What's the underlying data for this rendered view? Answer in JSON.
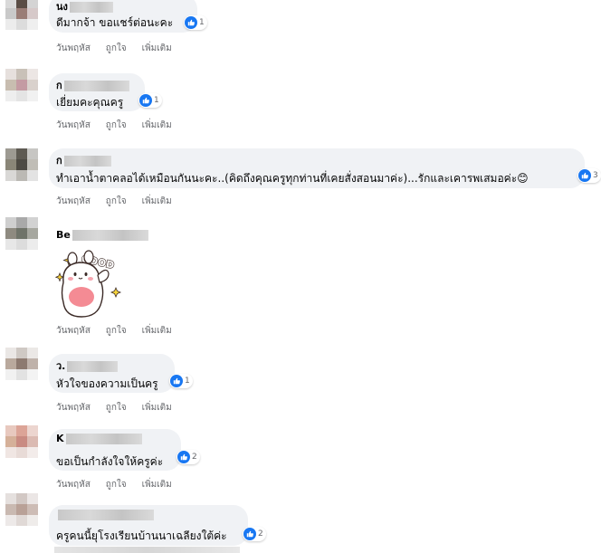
{
  "colors": {
    "bubble": "#f0f2f5",
    "like_blue": "#1877f2",
    "meta_gray": "#65676b"
  },
  "actions": {
    "translate": "วันพฤหัส",
    "like": "ถูกใจ",
    "more": "เพิ่มเติม"
  },
  "comments": [
    {
      "name": "นง",
      "text": "ดีมากจ้า ขอแชร์ต่อนะคะ",
      "reactions": "1",
      "reaction_icon": "like-icon"
    },
    {
      "name": "ก",
      "text": "เยี่ยมคะคุณครู",
      "reactions": "1",
      "reaction_icon": "like-icon"
    },
    {
      "name": "ก",
      "text": "ทำเอาน้ำตาคลอได้เหมือนกันนะคะ..(คิดถึงคุณครูทุกท่านที่เคยสั่งสอนมาค่ะ)...รักและเคารพเสมอค่ะ😊",
      "reactions": "3",
      "reaction_icon": "like-icon"
    },
    {
      "name": "Be",
      "sticker": "GOOD",
      "sticker_icon": "bear-good-sticker"
    },
    {
      "name": "ว.",
      "text": "หัวใจของความเป็นครู",
      "reactions": "1",
      "reaction_icon": "like-icon"
    },
    {
      "name": "K",
      "text": "ขอเป็นกำลังใจให้ครูค่ะ",
      "reactions": "2",
      "reaction_icon": "like-icon"
    },
    {
      "name": "",
      "text": "ครูคนนี้ยุโรงเรียนบ้านนาเฉลียงใต้ค่ะ",
      "reactions": "2",
      "reaction_icon": "like-icon"
    }
  ]
}
